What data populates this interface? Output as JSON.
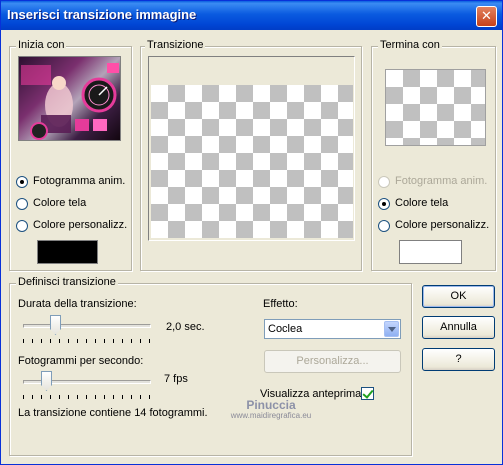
{
  "dialog": {
    "title": "Inserisci transizione immagine",
    "close_glyph": "✕"
  },
  "start_group": {
    "label": "Inizia con",
    "options": [
      {
        "label": "Fotogramma anim.",
        "selected": true,
        "enabled": true
      },
      {
        "label": "Colore tela",
        "selected": false,
        "enabled": true
      },
      {
        "label": "Colore personalizz.",
        "selected": false,
        "enabled": true
      }
    ],
    "custom_color": "#000000",
    "thumbnail_icon": "animation-frame-thumbnail"
  },
  "transition_group": {
    "label": "Transizione"
  },
  "end_group": {
    "label": "Termina con",
    "options": [
      {
        "label": "Fotogramma anim.",
        "selected": false,
        "enabled": false
      },
      {
        "label": "Colore tela",
        "selected": true,
        "enabled": true
      },
      {
        "label": "Colore personalizz.",
        "selected": false,
        "enabled": true
      }
    ],
    "custom_color": "#ffffff"
  },
  "define_group": {
    "label": "Definisci transizione",
    "duration_label": "Durata della transizione:",
    "duration_value": "2,0 sec.",
    "fps_label": "Fotogrammi per secondo:",
    "fps_value": "7 fps",
    "summary": "La transizione contiene 14 fotogrammi.",
    "effect_label": "Effetto:",
    "effect_selected": "Coclea",
    "customize_label": "Personalizza...",
    "preview_label": "Visualizza anteprima",
    "preview_checked": true,
    "duration_slider_fraction": 0.22,
    "fps_slider_fraction": 0.15
  },
  "buttons": {
    "ok": "OK",
    "cancel": "Annulla",
    "help": "?"
  },
  "watermark": {
    "line1": "Pinuccia",
    "line2": "www.maidiregrafica.eu"
  },
  "colors": {
    "titlebar": "#0054e3",
    "dialog_bg": "#ece9d8",
    "checker": "#c0c0c0"
  }
}
